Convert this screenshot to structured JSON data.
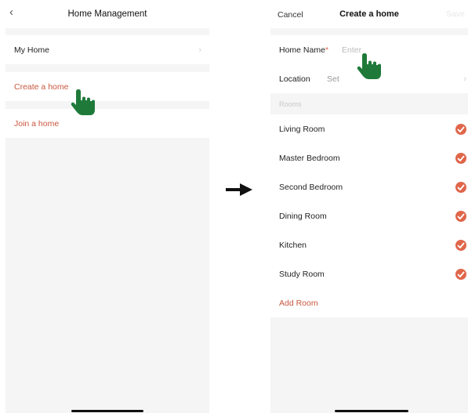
{
  "left": {
    "nav": {
      "title": "Home Management"
    },
    "rows": [
      {
        "label": "My Home"
      },
      {
        "label": "Create a home"
      },
      {
        "label": "Join a home"
      }
    ]
  },
  "right": {
    "nav": {
      "cancel": "Cancel",
      "title": "Create a home",
      "save": "Save"
    },
    "home_name": {
      "label": "Home Name",
      "required_mark": "*",
      "placeholder": "Enter"
    },
    "location": {
      "label": "Location",
      "value": "Set"
    },
    "rooms_header": "Rooms",
    "rooms": [
      {
        "label": "Living Room",
        "checked": true
      },
      {
        "label": "Master Bedroom",
        "checked": true
      },
      {
        "label": "Second Bedroom",
        "checked": true
      },
      {
        "label": "Dining Room",
        "checked": true
      },
      {
        "label": "Kitchen",
        "checked": true
      },
      {
        "label": "Study Room",
        "checked": true
      }
    ],
    "add_room": "Add Room"
  },
  "colors": {
    "accent": "#c9573f",
    "check_fill": "#e0664a",
    "pointer_hand": "#1f7a3a",
    "background": "#f5f5f5"
  },
  "icons": {
    "back": "chevron-left-icon",
    "disclosure": "chevron-right-icon",
    "checked": "check-circle-icon",
    "pointer": "pointing-hand-icon",
    "transition": "arrow-right-icon"
  }
}
